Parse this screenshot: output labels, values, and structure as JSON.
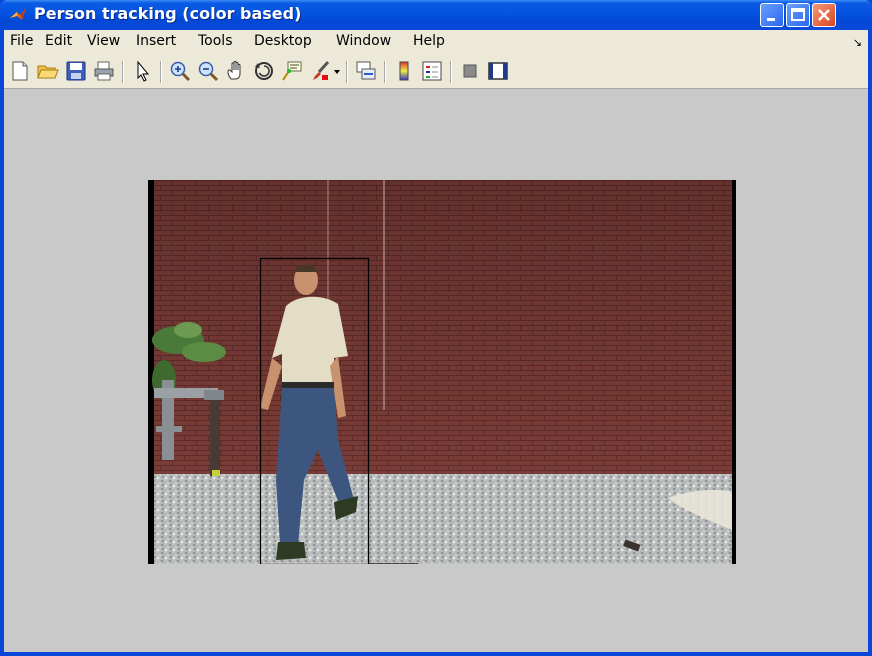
{
  "window": {
    "title": "Person tracking (color based)"
  },
  "menu": {
    "items": [
      "File",
      "Edit",
      "View",
      "Insert",
      "Tools",
      "Desktop",
      "Window",
      "Help"
    ]
  },
  "toolbar": {
    "buttons": [
      "new-figure-icon",
      "open-file-icon",
      "save-icon",
      "print-icon",
      "edit-plot-arrow-icon",
      "zoom-in-icon",
      "zoom-out-icon",
      "pan-hand-icon",
      "rotate-3d-icon",
      "data-cursor-icon",
      "brush-icon",
      "brush-dropdown-icon",
      "link-plot-icon",
      "colorbar-icon",
      "legend-icon",
      "hide-plot-tools-icon",
      "show-plot-tools-icon"
    ]
  },
  "colors": {
    "titlebar": "#0553e0",
    "figure_background": "#c9c9c9",
    "brick": "#7a3a35",
    "tracking_box": "#000000"
  },
  "tracking": {
    "target": "person",
    "method": "color based"
  }
}
